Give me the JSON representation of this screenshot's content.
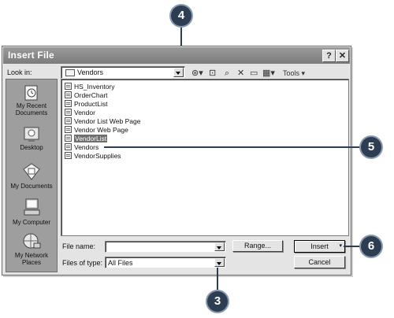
{
  "dialog": {
    "title": "Insert File",
    "title_buttons": {
      "help": "?",
      "close": "✕"
    }
  },
  "look_in": {
    "label": "Look in:",
    "value": "Vendors"
  },
  "toolbar": {
    "tools_label": "Tools",
    "icons": [
      "back-icon",
      "up-folder-icon",
      "search-web-icon",
      "delete-icon",
      "new-folder-icon",
      "views-icon"
    ]
  },
  "places": [
    {
      "label": "My Recent Documents",
      "icon": "recent-documents-icon"
    },
    {
      "label": "Desktop",
      "icon": "desktop-icon"
    },
    {
      "label": "My Documents",
      "icon": "my-documents-icon"
    },
    {
      "label": "My Computer",
      "icon": "my-computer-icon"
    },
    {
      "label": "My Network Places",
      "icon": "network-places-icon"
    }
  ],
  "files": [
    {
      "name": "HS_Inventory",
      "selected": false
    },
    {
      "name": "OrderChart",
      "selected": false
    },
    {
      "name": "ProductList",
      "selected": false
    },
    {
      "name": "Vendor",
      "selected": false
    },
    {
      "name": "Vendor List Web Page",
      "selected": false
    },
    {
      "name": "Vendor Web Page",
      "selected": false
    },
    {
      "name": "VendorList",
      "selected": true
    },
    {
      "name": "Vendors",
      "selected": false
    },
    {
      "name": "VendorSupplies",
      "selected": false
    }
  ],
  "file_name": {
    "label": "File name:",
    "value": ""
  },
  "files_of_type": {
    "label": "Files of type:",
    "value": "All Files"
  },
  "buttons": {
    "range": "Range...",
    "insert": "Insert",
    "cancel": "Cancel"
  },
  "callouts": [
    "4",
    "5",
    "6",
    "3"
  ],
  "colors": {
    "callout": "#2d3d52",
    "titlebar": "#8a8a8a",
    "selection": "#6f6f6f"
  }
}
